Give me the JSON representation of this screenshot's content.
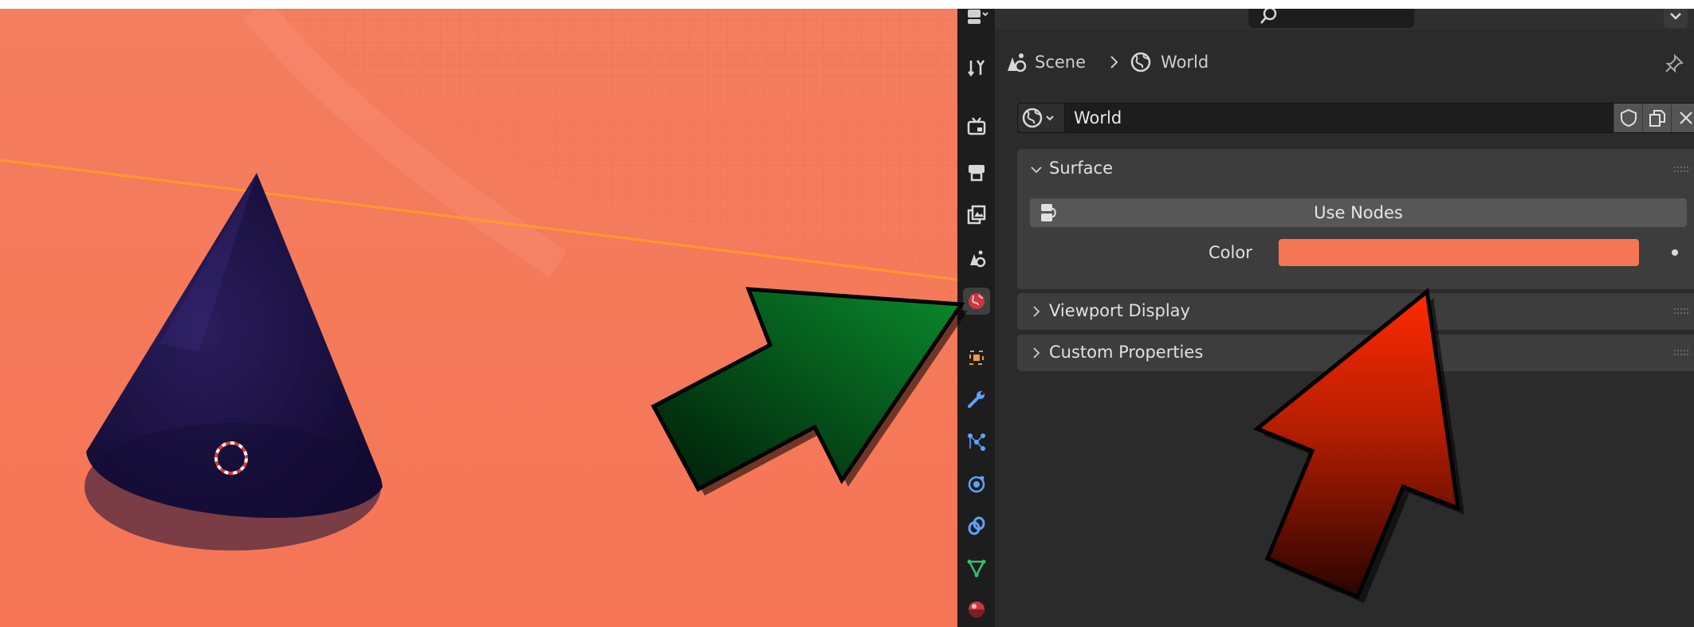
{
  "properties": {
    "breadcrumb": [
      "Scene",
      "World"
    ],
    "datablock": {
      "name": "World"
    },
    "panels": {
      "surface": {
        "title": "Surface",
        "use_nodes_label": "Use Nodes",
        "color_label": "Color",
        "color_value": "#f57655"
      },
      "viewport_display": {
        "title": "Viewport Display"
      },
      "custom_properties": {
        "title": "Custom Properties"
      }
    },
    "tabs": [
      "tool-tab-icon",
      "render-tab-icon",
      "output-tab-icon",
      "view-layer-tab-icon",
      "scene-tab-icon",
      "world-tab-icon",
      "object-tab-icon",
      "modifiers-tab-icon",
      "particles-tab-icon",
      "physics-tab-icon",
      "constraints-tab-icon",
      "object-data-tab-icon",
      "material-tab-icon"
    ],
    "active_tab": "world-tab-icon"
  },
  "viewport": {
    "background_color": "#f57655",
    "object": "cone",
    "object_color": "#1c1244"
  },
  "annotations": {
    "green_arrow_color": "#0a8a2c",
    "red_arrow_color": "#e82a00"
  }
}
